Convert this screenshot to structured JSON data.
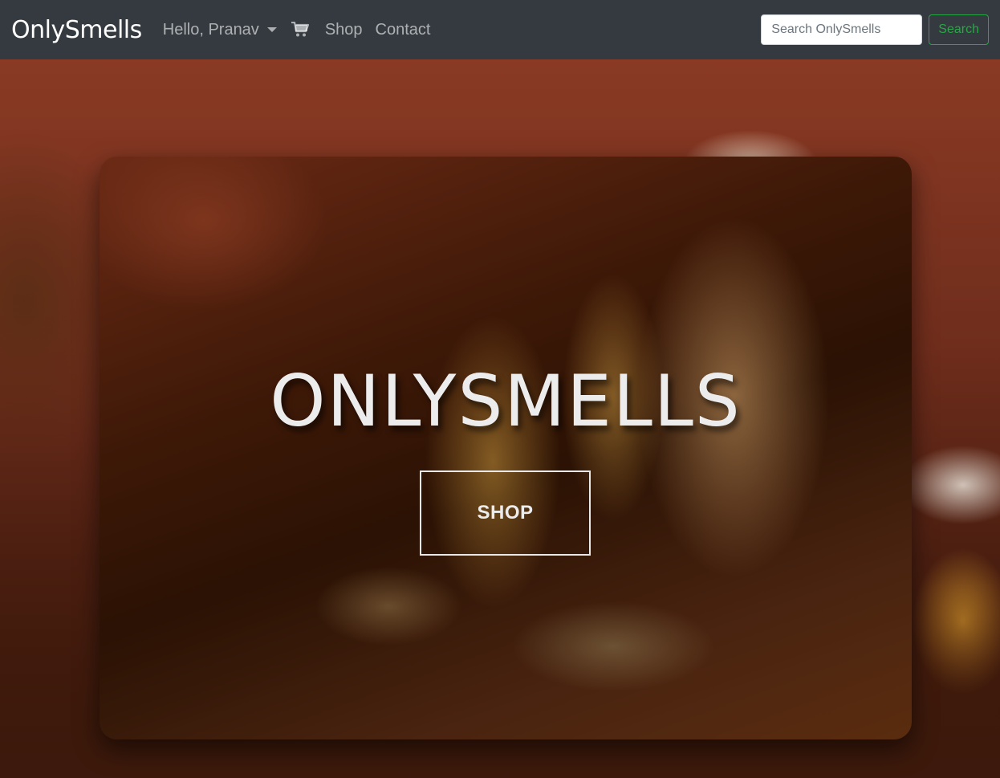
{
  "navbar": {
    "brand": "OnlySmells",
    "user_menu_label": "Hello, Pranav",
    "cart_icon": "shopping-cart-icon",
    "links": [
      "Shop",
      "Contact"
    ],
    "search": {
      "placeholder": "Search OnlySmells",
      "button_label": "Search"
    },
    "colors": {
      "background": "#343a40",
      "search_button": "#28a745"
    }
  },
  "hero": {
    "title": "ONLYSMELLS",
    "button_label": "SHOP"
  }
}
